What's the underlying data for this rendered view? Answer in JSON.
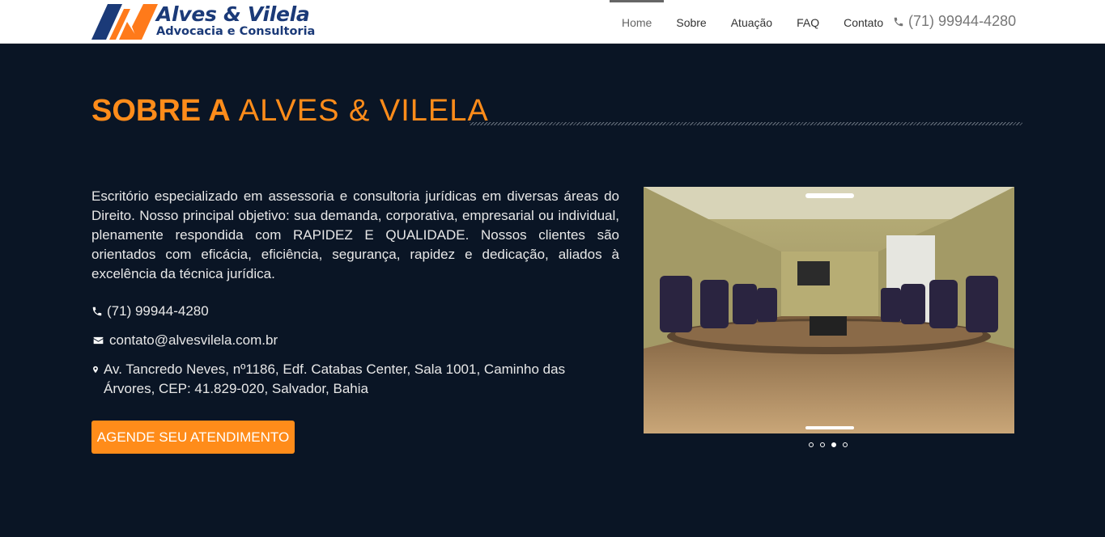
{
  "header": {
    "logo_title": "Alves & Vilela",
    "logo_subtitle": "Advocacia e Consultoria",
    "nav": [
      {
        "label": "Home",
        "active": true
      },
      {
        "label": "Sobre",
        "active": false
      },
      {
        "label": "Atuação",
        "active": false
      },
      {
        "label": "FAQ",
        "active": false
      },
      {
        "label": "Contato",
        "active": false
      }
    ],
    "phone": "(71) 99944-4280",
    "phone_icon": "phone-icon"
  },
  "section": {
    "title_bold": "SOBRE A",
    "title_light": "ALVES & VILELA",
    "description": "Escritório especializado em assessoria e consultoria jurídicas em diversas áreas do Direito. Nosso principal objetivo: sua demanda, corporativa, empresarial ou individual, plenamente respondida com RAPIDEZ E QUALIDADE. Nossos clientes são orientados com eficácia, eficiência, segurança, rapidez e dedicação, aliados à excelência da técnica jurídica.",
    "phone": "(71) 99944-4280",
    "email": "contato@alvesvilela.com.br",
    "address": "Av. Tancredo Neves, nº1186, Edf. Catabas Center, Sala 1001, Caminho das Árvores, CEP: 41.829-020, Salvador, Bahia",
    "cta_label": "AGENDE SEU ATENDIMENTO"
  },
  "slider": {
    "dots": 4,
    "active_dot": 2
  },
  "colors": {
    "background": "#0a1525",
    "accent": "#ff8c1a",
    "header_bg": "#ffffff",
    "logo_blue": "#1b3a78"
  }
}
